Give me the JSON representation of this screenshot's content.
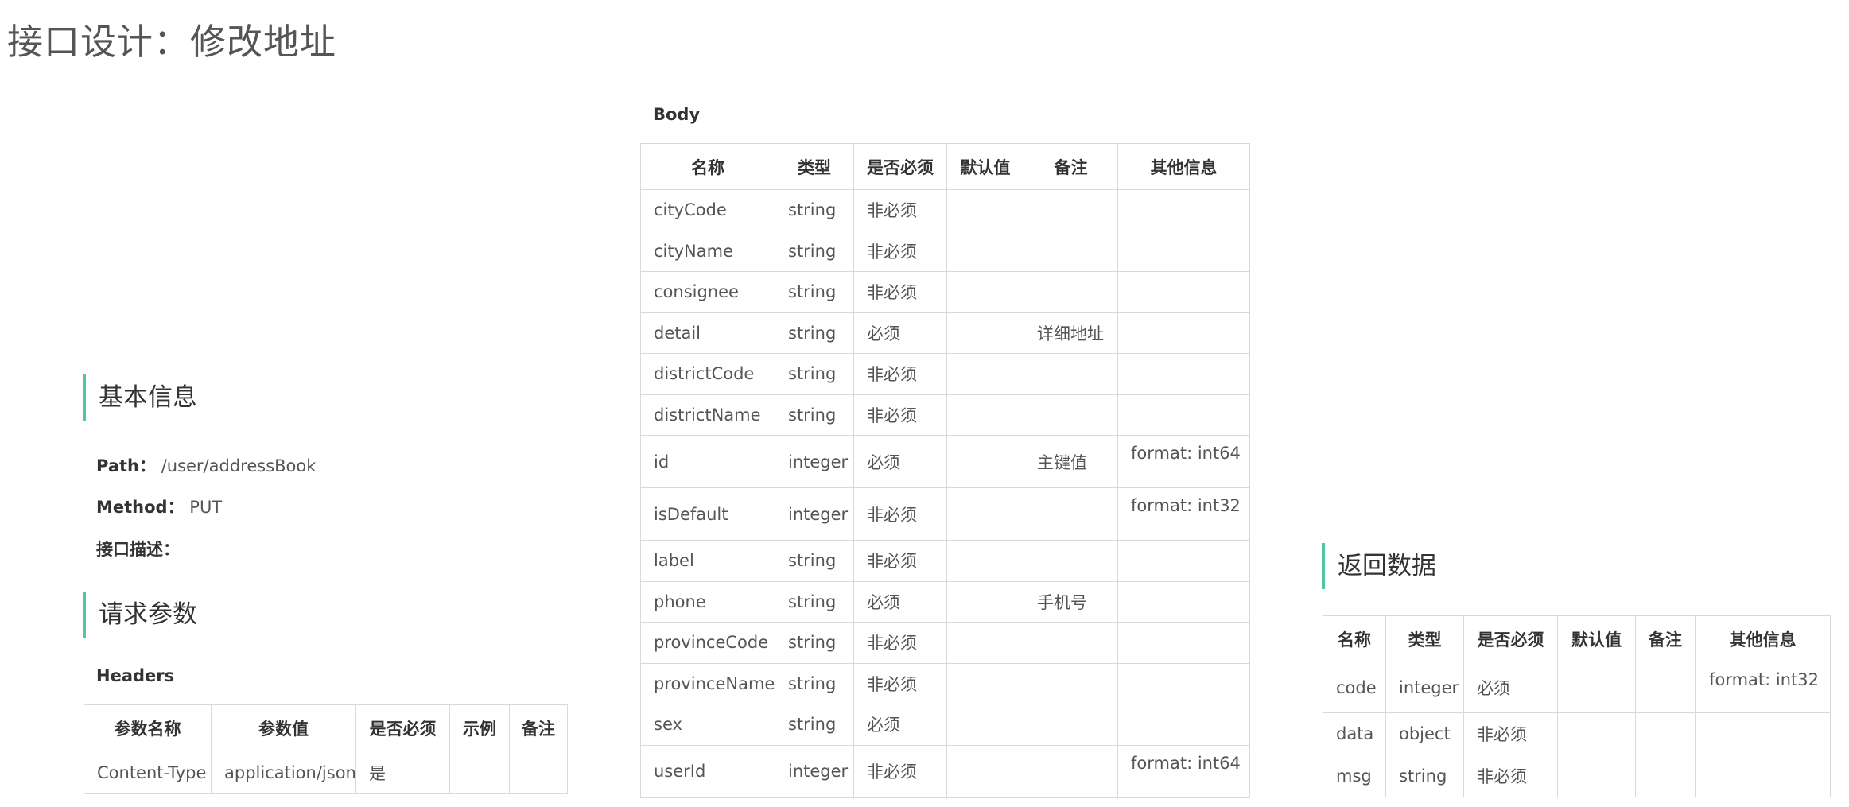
{
  "page_title": "接口设计：修改地址",
  "basic_info": {
    "heading": "基本信息",
    "path_label": "Path：",
    "path_value": "/user/addressBook",
    "method_label": "Method：",
    "method_value": "PUT",
    "desc_label": "接口描述："
  },
  "request": {
    "heading": "请求参数",
    "headers_label": "Headers",
    "headers_table": {
      "columns": [
        "参数名称",
        "参数值",
        "是否必须",
        "示例",
        "备注"
      ],
      "rows": [
        [
          "Content-Type",
          "application/json",
          "是",
          "",
          ""
        ]
      ]
    }
  },
  "body": {
    "label": "Body",
    "columns": [
      "名称",
      "类型",
      "是否必须",
      "默认值",
      "备注",
      "其他信息"
    ],
    "rows": [
      [
        "cityCode",
        "string",
        "非必须",
        "",
        "",
        ""
      ],
      [
        "cityName",
        "string",
        "非必须",
        "",
        "",
        ""
      ],
      [
        "consignee",
        "string",
        "非必须",
        "",
        "",
        ""
      ],
      [
        "detail",
        "string",
        "必须",
        "",
        "详细地址",
        ""
      ],
      [
        "districtCode",
        "string",
        "非必须",
        "",
        "",
        ""
      ],
      [
        "districtName",
        "string",
        "非必须",
        "",
        "",
        ""
      ],
      [
        "id",
        "integer",
        "必须",
        "",
        "主键值",
        "format: int64"
      ],
      [
        "isDefault",
        "integer",
        "非必须",
        "",
        "",
        "format: int32"
      ],
      [
        "label",
        "string",
        "非必须",
        "",
        "",
        ""
      ],
      [
        "phone",
        "string",
        "必须",
        "",
        "手机号",
        ""
      ],
      [
        "provinceCode",
        "string",
        "非必须",
        "",
        "",
        ""
      ],
      [
        "provinceName",
        "string",
        "非必须",
        "",
        "",
        ""
      ],
      [
        "sex",
        "string",
        "必须",
        "",
        "",
        ""
      ],
      [
        "userId",
        "integer",
        "非必须",
        "",
        "",
        "format: int64"
      ]
    ]
  },
  "response": {
    "heading": "返回数据",
    "columns": [
      "名称",
      "类型",
      "是否必须",
      "默认值",
      "备注",
      "其他信息"
    ],
    "rows": [
      [
        "code",
        "integer",
        "必须",
        "",
        "",
        "format: int32"
      ],
      [
        "data",
        "object",
        "非必须",
        "",
        "",
        ""
      ],
      [
        "msg",
        "string",
        "非必须",
        "",
        "",
        ""
      ]
    ]
  },
  "colors": {
    "accent": "#53c79a",
    "border": "#d9d9d9",
    "text": "#555555",
    "title": "#555555"
  }
}
